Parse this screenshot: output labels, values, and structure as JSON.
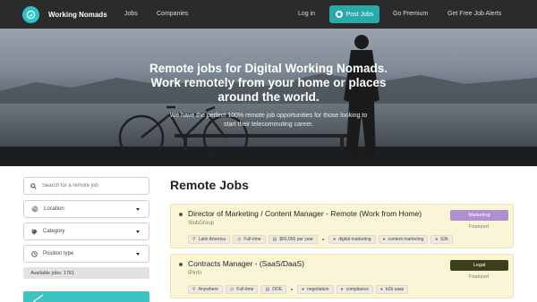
{
  "nav": {
    "brand": "Working Nomads",
    "links": [
      "Jobs",
      "Companies"
    ],
    "login": "Log in",
    "post_jobs": "Post Jobs",
    "go_premium": "Go Premium",
    "alerts": "Get Free Job Alerts"
  },
  "hero": {
    "title_line1": "Remote jobs for Digital Working Nomads.",
    "title_line2": "Work remotely from your home or places",
    "title_line3": "around the world.",
    "subtitle_line1": "We have the perfect 100% remote job opportunities for those looking to",
    "subtitle_line2": "start their telecommuting career."
  },
  "sidebar": {
    "search_placeholder": "Search for a remote job",
    "filters": [
      "Location",
      "Category",
      "Position type"
    ],
    "available": "Available jobs: 1761"
  },
  "main": {
    "title": "Remote Jobs",
    "jobs": [
      {
        "title": "Director of Marketing / Content Manager - Remote (Work from Home)",
        "company": "StubGroup",
        "badge": "Marketing",
        "badge_color": "#b08fce",
        "featured": "Featured",
        "meta": [
          "Latin America",
          "Full-time",
          "$60,000 per year"
        ],
        "tags": [
          "digital marketing",
          "content marketing",
          "b2b"
        ]
      },
      {
        "title": "Contracts Manager - (SaaS/DaaS)",
        "company": "IPinfo",
        "badge": "Legal",
        "badge_color": "#3b3f1c",
        "featured": "Featured",
        "meta": [
          "Anywhere",
          "Full-time",
          "DOE"
        ],
        "tags": [
          "negotiation",
          "compliance",
          "b2b saas"
        ]
      }
    ]
  },
  "colors": {
    "accent": "#2cc4c6",
    "nav_bg": "#2b2b2b",
    "job_bg": "#fbf5d8"
  }
}
